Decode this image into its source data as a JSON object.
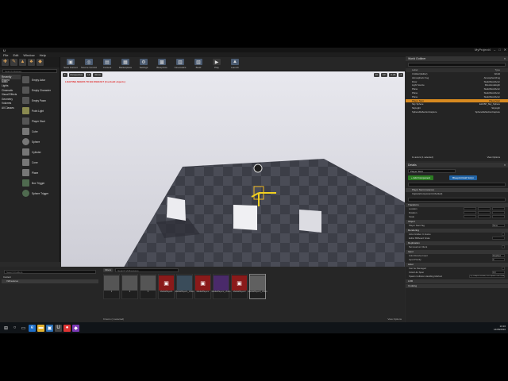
{
  "window": {
    "title_icon": "ue-logo-icon",
    "project_name": "MyProject4",
    "controls": [
      "–",
      "□",
      "✕"
    ]
  },
  "menu": [
    "File",
    "Edit",
    "Window",
    "Help"
  ],
  "toolbar": [
    "Save Current",
    "Source Control",
    "Content",
    "Marketplace",
    "Settings",
    "Blueprints",
    "Cinematics",
    "Build",
    "Play",
    "Launch"
  ],
  "modes": {
    "search_placeholder": "Search Classes",
    "categories": [
      "Recently Placed",
      "Basic",
      "Lights",
      "Cinematic",
      "Visual Effects",
      "Geometry",
      "Volumes",
      "All Classes"
    ],
    "items": [
      "Empty Actor",
      "Empty Character",
      "Empty Pawn",
      "Point Light",
      "Player Start",
      "Cube",
      "Sphere",
      "Cylinder",
      "Cone",
      "Plane",
      "Box Trigger",
      "Sphere Trigger"
    ]
  },
  "viewport": {
    "buttons": [
      "Perspective",
      "Lit",
      "Show"
    ],
    "warning": "LIGHTING NEEDS TO BE REBUILT (3 unbuilt objects)",
    "grid_value": "10",
    "angle_value": "10°",
    "scale_value": "0.25",
    "camera_value": "4"
  },
  "outliner": {
    "title": "World Outliner",
    "columns": [
      "Label",
      "Type"
    ],
    "rows": [
      {
        "label": "Untitled (Editor)",
        "type": "World"
      },
      {
        "label": "Atmospheric Fog",
        "type": "AtmosphericFog"
      },
      {
        "label": "Floor",
        "type": "StaticMeshActor"
      },
      {
        "label": "Light Source",
        "type": "DirectionalLight"
      },
      {
        "label": "Plane",
        "type": "StaticMeshActor"
      },
      {
        "label": "Plane",
        "type": "StaticMeshActor"
      },
      {
        "label": "Plane",
        "type": "StaticMeshActor"
      },
      {
        "label": "Player Start",
        "type": "PlayerStart"
      },
      {
        "label": "Sky Sphere",
        "type": "Edit BP_Sky_Sphere"
      },
      {
        "label": "SkyLight",
        "type": "SkyLight"
      },
      {
        "label": "SphereReflectionCapture",
        "type": "SphereReflectionCapture"
      }
    ],
    "selected_index": 7,
    "footer": "11 actors (1 selected)",
    "view_options": "View Options"
  },
  "details": {
    "title": "Details",
    "actor_name": "Player Start",
    "add_component": "+ Add Component",
    "blueprint": "Blueprint/Add Script",
    "components": [
      "Player Start (Instance)",
      "CapsuleComponent (Inherited)"
    ],
    "sections": [
      "Transform",
      "Object",
      "Rendering",
      "Replication",
      "Input",
      "Actor",
      "LOD",
      "Cooking"
    ],
    "transform": {
      "location": [
        "0.0",
        "0.0",
        "0.0"
      ],
      "rotation": [
        "0.0",
        "0.0",
        "0.0"
      ],
      "scale": [
        "1.0",
        "1.0",
        "1.0"
      ]
    },
    "props": [
      "Location",
      "Rotation",
      "Scale",
      "Player Start Tag",
      "Actor Hidden In Game",
      "Editor Billboard Scale",
      "Net Load on Client",
      "Auto Receive Input",
      "Input Priority",
      "Can be Damaged",
      "Initial Life Span",
      "Spawn Collision Handling Method"
    ],
    "values": [
      "None",
      "Disabled",
      "0",
      "0.0",
      "Try To Adjust Location, Don't Spawn If Still Colliding"
    ]
  },
  "content": {
    "tab1": "Content Browser",
    "tab2": "Sequencer",
    "add_new": "Add New",
    "import": "Import",
    "save_all": "Save All",
    "path": [
      "Content",
      "VidFeatures"
    ],
    "filters": "Filters",
    "search": "Search VidFeatures",
    "folder_search": "Search Folders",
    "tree": [
      "Content",
      "VidFeatures"
    ],
    "assets": [
      "1",
      "2",
      "3",
      "MediaPlayer1",
      "MediaPlayer1_Video",
      "MediaPlayer2",
      "MediaPlayer2_Video",
      "MediaPlayer3",
      "MediaPlayer3_Video"
    ],
    "status": "9 items (1 selected)",
    "view_options": "View Options"
  },
  "taskbar": {
    "time": "13:16",
    "date": "14/08/2016"
  },
  "colors": {
    "accent": "#d88a20",
    "add_green": "#2b7a22",
    "bp_blue": "#2163a4",
    "warning": "#e03030"
  }
}
